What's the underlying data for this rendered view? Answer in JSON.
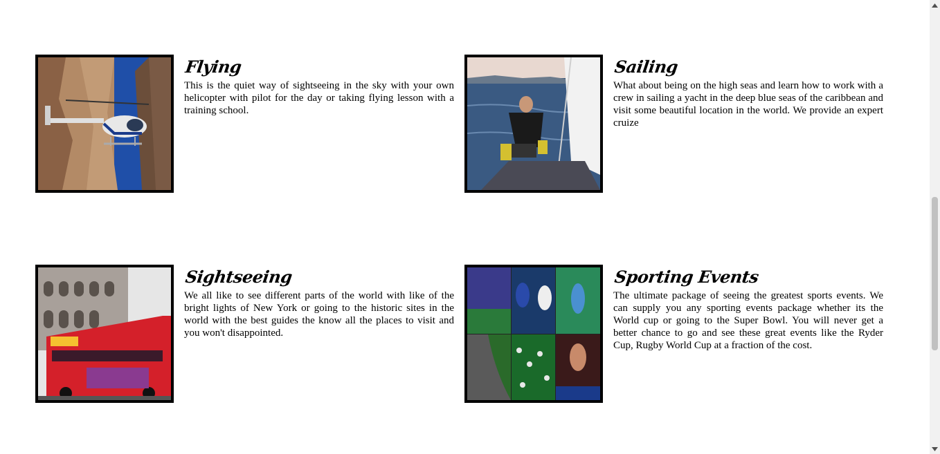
{
  "cards": [
    {
      "title": "Flying",
      "body": "This is the quiet way of sightseeing in the sky with your own helicopter with pilot for the day or taking flying lesson with a training school.",
      "image": "helicopter-photo"
    },
    {
      "title": "Sailing",
      "body": "What about being on the high seas and learn how to work with a crew in sailing a yacht in the deep blue seas of the caribbean and visit some beautiful location in the world. We provide an expert cruize",
      "image": "sailing-photo"
    },
    {
      "title": "Sightseeing",
      "body": "We all like to see different parts of the world with like of the bright lights of New York or going to the historic sites in the world with the best guides the know all the places to visit and you won't disappointed.",
      "image": "tour-bus-photo"
    },
    {
      "title": "Sporting Events",
      "body": "The ultimate package of seeing the greatest sports events. We can supply you any sporting events package whether its the World cup or going to the Super Bowl. You will never get a better chance to go and see these great events like the Ryder Cup, Rugby World Cup at a fraction of the cost.",
      "image": "sports-collage-photo"
    }
  ],
  "colors": {
    "border": "#000000",
    "text": "#000000",
    "background": "#ffffff"
  },
  "scrollbar": {
    "position_fraction": 0.45
  }
}
